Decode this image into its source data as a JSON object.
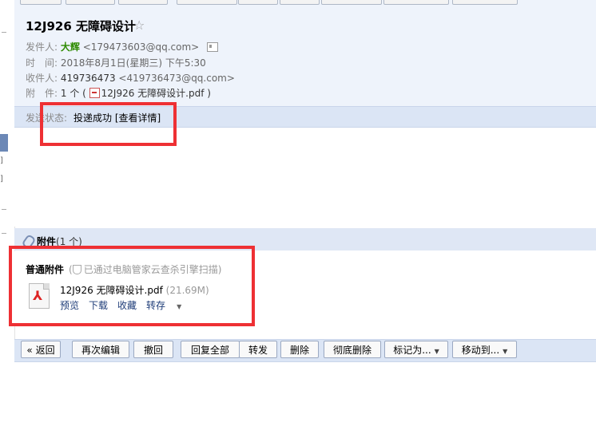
{
  "mail": {
    "subject": "12J926 无障碍设计",
    "star_icon": "star-outline-icon",
    "from_label": "发件人:",
    "from_name": "大辉",
    "from_email": "<179473603@qq.com>",
    "time_label": "时　间:",
    "time_value": "2018年8月1日(星期三) 下午5:30",
    "to_label": "收件人:",
    "to_name": "419736473",
    "to_email": "<419736473@qq.com>",
    "attach_label": "附　件:",
    "attach_count": "1 个 (",
    "attach_file": "12J926 无障碍设计.pdf",
    "attach_close": ")",
    "status_label": "发送状态:",
    "status_value": "投递成功",
    "status_link": "[查看详情]"
  },
  "attachments": {
    "header_title": "附件",
    "header_count": "(1 个)",
    "type_label": "普通附件",
    "scan_note": "已通过电脑管家云查杀引擎扫描)",
    "scan_open": "(",
    "file_name": "12J926 无障碍设计.pdf",
    "file_size": "(21.69M)",
    "actions": {
      "preview": "预览",
      "download": "下载",
      "favorite": "收藏",
      "save_to": "转存"
    }
  },
  "toolbar": {
    "back": "« 返回",
    "re_edit": "再次编辑",
    "recall": "撤回",
    "reply_all": "回复全部",
    "forward": "转发",
    "delete": "删除",
    "delete_forever": "彻底删除",
    "mark_as": "标记为...",
    "move_to": "移动到..."
  },
  "colors": {
    "annotation_red": "#ee3034",
    "header_bg": "#eef3fb",
    "bar_bg": "#dbe5f5"
  }
}
